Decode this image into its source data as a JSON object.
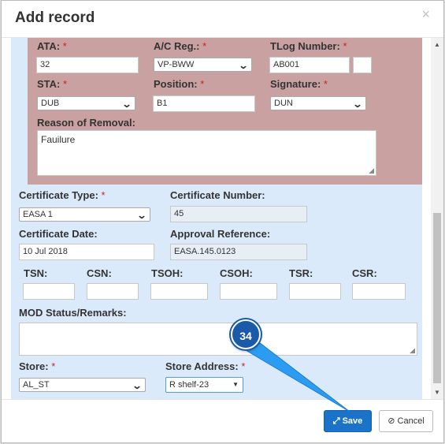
{
  "modal": {
    "title": "Add record",
    "close_glyph": "×"
  },
  "form": {
    "ata": {
      "label": "ATA:",
      "value": "32"
    },
    "ac_reg": {
      "label": "A/C Reg.:",
      "value": "VP-BWW"
    },
    "tlog": {
      "label": "TLog Number:",
      "value": "AB001",
      "extra_value": ""
    },
    "sta": {
      "label": "STA:",
      "value": "DUB"
    },
    "position": {
      "label": "Position:",
      "value": "B1"
    },
    "signature": {
      "label": "Signature:",
      "value": "DUN"
    },
    "reason": {
      "label": "Reason of Removal:",
      "value": "Fauilure"
    },
    "cert_type": {
      "label": "Certificate Type:",
      "value": "EASA 1"
    },
    "cert_number": {
      "label": "Certificate Number:",
      "value": "45"
    },
    "cert_date": {
      "label": "Certificate Date:",
      "value": "10 Jul 2018"
    },
    "approval_ref": {
      "label": "Approval Reference:",
      "value": "EASA.145.0123"
    },
    "tsn": {
      "label": "TSN:",
      "value": ""
    },
    "csn": {
      "label": "CSN:",
      "value": ""
    },
    "tsoh": {
      "label": "TSOH:",
      "value": ""
    },
    "csoh": {
      "label": "CSOH:",
      "value": ""
    },
    "tsr": {
      "label": "TSR:",
      "value": ""
    },
    "csr": {
      "label": "CSR:",
      "value": ""
    },
    "mod_status": {
      "label": "MOD Status/Remarks:",
      "value": ""
    },
    "store": {
      "label": "Store:",
      "value": "AL_ST"
    },
    "store_address": {
      "label": "Store Address:",
      "value": "R shelf-23"
    },
    "required_mark": "*"
  },
  "footer": {
    "save_label": "Save",
    "cancel_label": "Cancel",
    "save_icon": "⤢",
    "cancel_icon": "⊘"
  },
  "annotation": {
    "step": "34"
  },
  "colors": {
    "accent": "#1a73c9",
    "required": "#d42020",
    "panel_blue": "#dbeafa",
    "panel_red": "#c9a1a1"
  }
}
